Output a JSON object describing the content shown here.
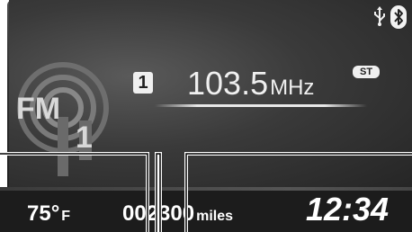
{
  "top_icons": {
    "usb": "usb-icon",
    "bluetooth": "bluetooth-icon"
  },
  "radio": {
    "band": "FM",
    "band_number": "1",
    "preset": "1",
    "frequency": "103.5",
    "frequency_unit": "MHz",
    "stereo": "ST"
  },
  "status_bar": {
    "temperature": "75°",
    "temperature_unit": "F",
    "odometer": "002300",
    "odometer_unit": "miles",
    "clock": "12:34"
  }
}
